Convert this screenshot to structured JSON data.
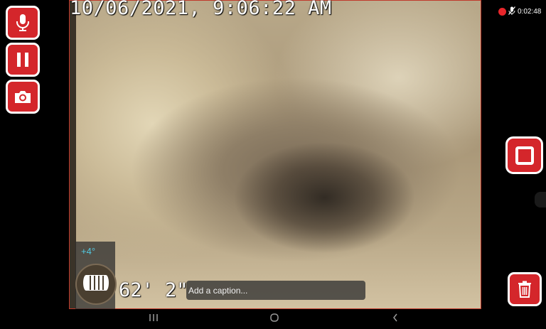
{
  "overlay": {
    "timestamp": "10/06/2021, 9:06:22 AM",
    "angle": "+4°",
    "distance": "62' 2\"",
    "caption_placeholder": "Add a caption..."
  },
  "status": {
    "recording_time": "0:02:48",
    "mic_icon": "mic-muted-icon",
    "recording_indicator_color": "#e8262b"
  },
  "left_toolbar": {
    "buttons": [
      {
        "name": "record-audio-button",
        "icon": "microphone-icon"
      },
      {
        "name": "pause-button",
        "icon": "pause-icon"
      },
      {
        "name": "snapshot-button",
        "icon": "camera-icon"
      }
    ]
  },
  "right_toolbar": {
    "buttons": [
      {
        "name": "stop-button",
        "icon": "stop-icon"
      },
      {
        "name": "delete-button",
        "icon": "trash-icon"
      }
    ]
  },
  "navbar": {
    "buttons": [
      "recents-icon",
      "home-icon",
      "back-icon"
    ]
  },
  "colors": {
    "accent_red": "#d4262b",
    "angle_cyan": "#53c8e0",
    "background": "#000000"
  }
}
